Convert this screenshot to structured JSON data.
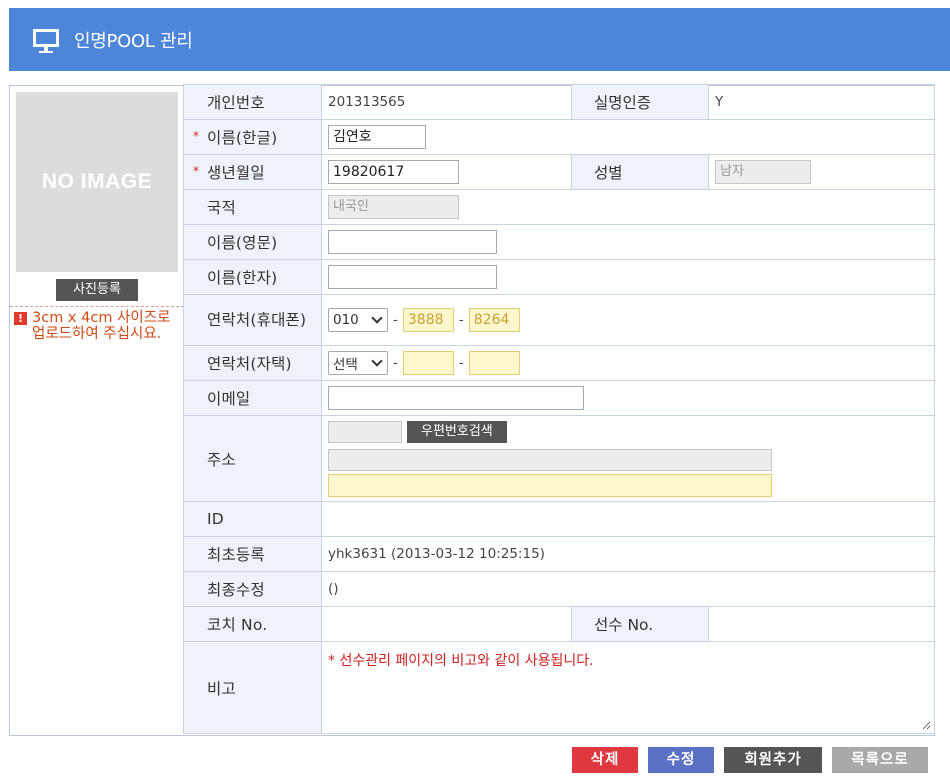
{
  "header": {
    "title": "인명POOL 관리",
    "icon": "monitor-icon",
    "color": "#4d86d9"
  },
  "photo": {
    "placeholder": "NO IMAGE",
    "upload_label": "사진등록",
    "note": "3cm x 4cm 사이즈로 업로드하여 주십시요.",
    "note_icon": "warning-icon"
  },
  "form": {
    "personal_no": {
      "label": "개인번호",
      "value": "201313565"
    },
    "verified": {
      "label": "실명인증",
      "value": "Y"
    },
    "name_kr": {
      "label": "이름(한글)",
      "value": "김연호"
    },
    "birth": {
      "label": "생년월일",
      "value": "19820617"
    },
    "gender": {
      "label": "성별",
      "value": "남자"
    },
    "nationality": {
      "label": "국적",
      "value": "내국인"
    },
    "name_en": {
      "label": "이름(영문)",
      "value": ""
    },
    "name_hanja": {
      "label": "이름(한자)",
      "value": ""
    },
    "mobile": {
      "label": "연락처(휴대폰)",
      "prefix": "010",
      "mid": "3888",
      "last": "8264"
    },
    "home": {
      "label": "연락처(자택)",
      "prefix": "선택",
      "mid": "",
      "last": ""
    },
    "email": {
      "label": "이메일",
      "value": ""
    },
    "address": {
      "label": "주소",
      "search_label": "우편번호검색",
      "zip": "",
      "line1": "",
      "line2": ""
    },
    "id": {
      "label": "ID",
      "value": ""
    },
    "created": {
      "label": "최초등록",
      "value": "yhk3631 (2013-03-12 10:25:15)"
    },
    "modified": {
      "label": "최종수정",
      "value": "()"
    },
    "coach_no": {
      "label": "코치 No.",
      "value": ""
    },
    "player_no": {
      "label": "선수 No.",
      "value": ""
    },
    "remark": {
      "label": "비고",
      "hint": "* 선수관리 페이지의 비고와 같이 사용됩니다."
    }
  },
  "buttons": {
    "delete": "삭제",
    "edit": "수정",
    "add_member": "회원추가",
    "list": "목록으로"
  },
  "colors": {
    "delete": "#e0383e",
    "edit": "#5b72c4",
    "add_member": "#555555",
    "list": "#a9a9a9"
  }
}
